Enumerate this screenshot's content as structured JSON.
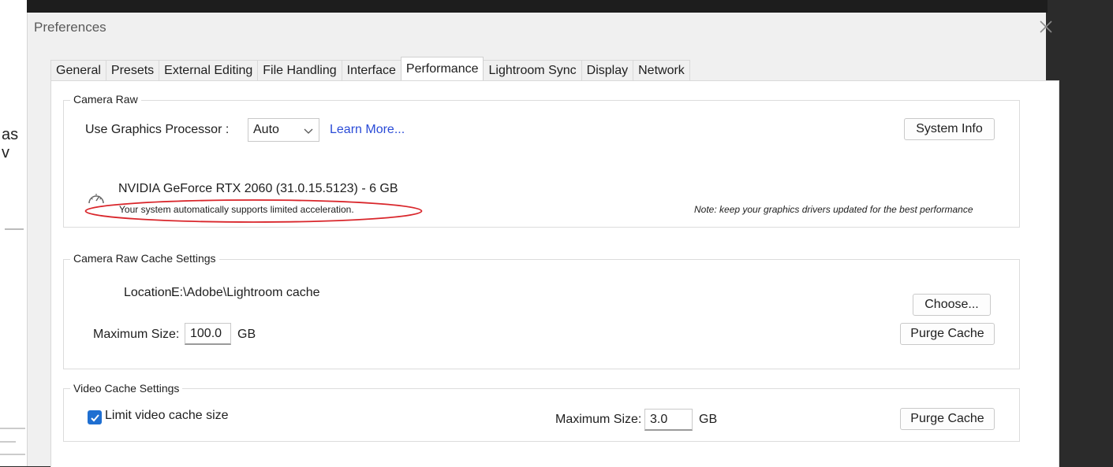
{
  "background": {
    "left_fragment": "as v"
  },
  "dialog": {
    "title": "Preferences",
    "close_label": "✕"
  },
  "tabs": [
    {
      "label": "General",
      "active": false
    },
    {
      "label": "Presets",
      "active": false
    },
    {
      "label": "External Editing",
      "active": false
    },
    {
      "label": "File Handling",
      "active": false
    },
    {
      "label": "Interface",
      "active": false
    },
    {
      "label": "Performance",
      "active": true
    },
    {
      "label": "Lightroom Sync",
      "active": false
    },
    {
      "label": "Display",
      "active": false
    },
    {
      "label": "Network",
      "active": false
    }
  ],
  "camera_raw": {
    "group_title": "Camera Raw",
    "gpu_label": "Use Graphics Processor :",
    "gpu_value": "Auto",
    "learn_more": "Learn More...",
    "system_info": "System Info",
    "gpu_name": "NVIDIA GeForce RTX 2060 (31.0.15.5123) - 6 GB",
    "gpu_status": "Your system automatically supports limited acceleration.",
    "note": "Note: keep your graphics drivers updated for the best performance",
    "highlight_color": "#d9262b"
  },
  "cache": {
    "group_title": "Camera Raw Cache Settings",
    "location_label": "Location:",
    "location_value": "E:\\Adobe\\Lightroom cache",
    "choose": "Choose...",
    "max_label": "Maximum Size:",
    "max_value": "100.0",
    "unit": "GB",
    "purge": "Purge Cache"
  },
  "video_cache": {
    "group_title": "Video Cache Settings",
    "limit_label": "Limit video cache size",
    "limit_checked": true,
    "max_label": "Maximum Size:",
    "max_value": "3.0",
    "unit": "GB",
    "purge": "Purge Cache"
  },
  "colors": {
    "accent": "#1f6fd1",
    "link": "#2a4bd7"
  }
}
